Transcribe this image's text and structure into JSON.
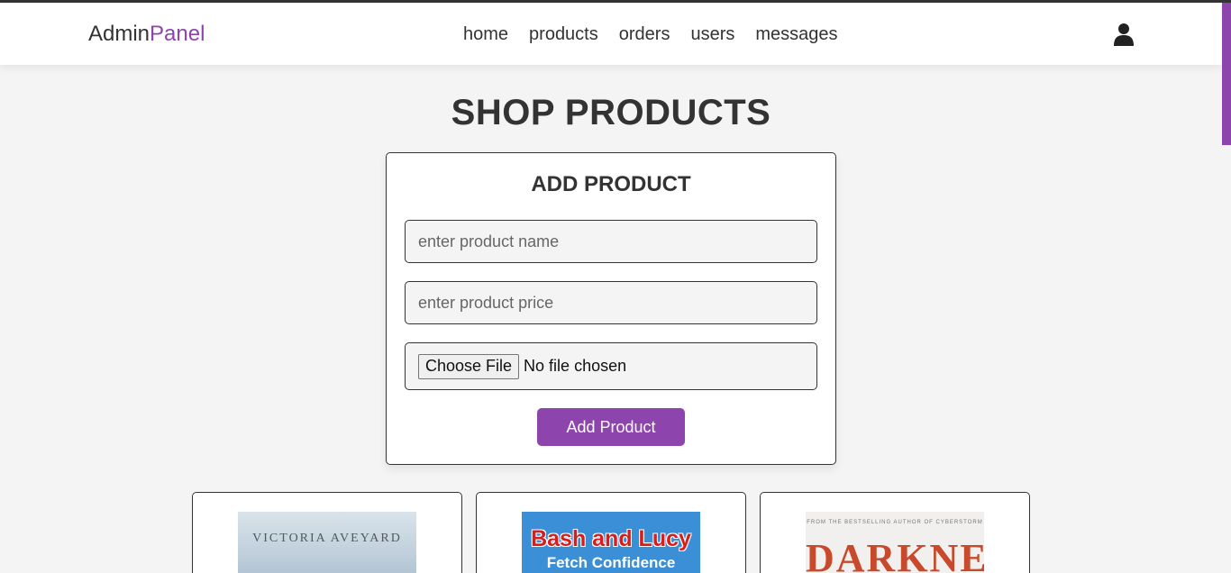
{
  "header": {
    "logo_main": "Admin",
    "logo_accent": "Panel",
    "nav": [
      "home",
      "products",
      "orders",
      "users",
      "messages"
    ],
    "user_icon": "user-icon"
  },
  "page_title": "SHOP PRODUCTS",
  "form": {
    "title": "ADD PRODUCT",
    "name_placeholder": "enter product name",
    "price_placeholder": "enter product price",
    "file_button": "Choose File",
    "file_status": "No file chosen",
    "submit_label": "Add Product"
  },
  "products": [
    {
      "cover_text": "VICTORIA AVEYARD"
    },
    {
      "cover_title": "Bash and Lucy",
      "cover_subtitle": "Fetch Confidence"
    },
    {
      "cover_small": "FROM THE BESTSELLING AUTHOR OF CYBERSTORM",
      "cover_title": "DARKNET"
    }
  ],
  "colors": {
    "accent": "#8e44ad",
    "text": "#333333",
    "background": "#f4f4f4"
  }
}
